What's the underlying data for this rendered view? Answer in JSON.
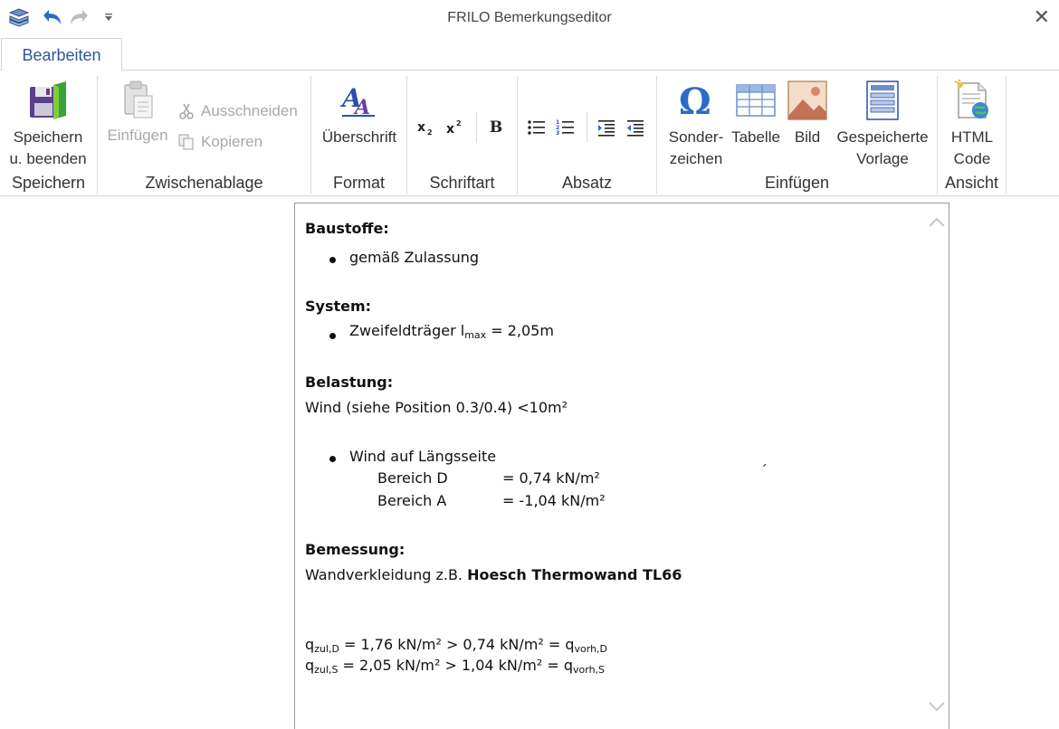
{
  "window": {
    "title": "FRILO Bemerkungseditor"
  },
  "tabs": [
    {
      "label": "Bearbeiten"
    }
  ],
  "ribbon": {
    "speichern": {
      "label": "Speichern",
      "save_button": "Speichern",
      "save_button_line2": "u. beenden"
    },
    "zwischenablage": {
      "label": "Zwischenablage",
      "paste": "Einfügen",
      "cut": "Ausschneiden",
      "copy": "Kopieren"
    },
    "format": {
      "label": "Format",
      "heading": "Überschrift"
    },
    "schriftart": {
      "label": "Schriftart",
      "bold": "B"
    },
    "absatz": {
      "label": "Absatz"
    },
    "einfuegen": {
      "label": "Einfügen",
      "special_line1": "Sonder-",
      "special_line2": "zeichen",
      "table": "Tabelle",
      "image": "Bild",
      "template_line1": "Gespeicherte",
      "template_line2": "Vorlage"
    },
    "ansicht": {
      "label": "Ansicht",
      "html_line1": "HTML",
      "html_line2": "Code"
    }
  },
  "document": {
    "h_baustoffe": "Baustoffe:",
    "b_zulassung": "gemäß Zulassung",
    "h_system": "System:",
    "b_zweifeld_pre": "Zweifeldträger l",
    "b_zweifeld_sub": "max",
    "b_zweifeld_post": " = 2,05m",
    "h_belastung": "Belastung:",
    "wind": "Wind (siehe Position 0.3/0.4) <10m²",
    "b_wind_laengs": "Wind auf Längsseite",
    "bereich_d_name": "Bereich D",
    "bereich_d_value": "=  0,74 kN/m²",
    "bereich_a_name": "Bereich A",
    "bereich_a_value": "= -1,04 kN/m²",
    "stray_mark": "´",
    "h_bemessung": "Bemessung:",
    "wand_pre": "Wandverkleidung z.B. ",
    "wand_bold": "Hoesch Thermowand TL66",
    "q1_a": "q",
    "q1_a_sub": "zul,D",
    "q1_mid": " = 1,76 kN/m² > 0,74 kN/m² = q",
    "q1_b_sub": "vorh,D",
    "q2_a": "q",
    "q2_a_sub": "zul,S",
    "q2_mid": " = 2,05 kN/m² > 1,04 kN/m² = q",
    "q2_b_sub": "vorh,S"
  },
  "icons": {
    "app": "app-stack-icon",
    "undo": "undo-icon",
    "redo": "redo-icon",
    "customize": "chevron-down-icon",
    "close": "close-icon"
  },
  "colors": {
    "accent": "#2b579a",
    "disabled": "#a8a8a8",
    "border": "#d5d5d5"
  }
}
